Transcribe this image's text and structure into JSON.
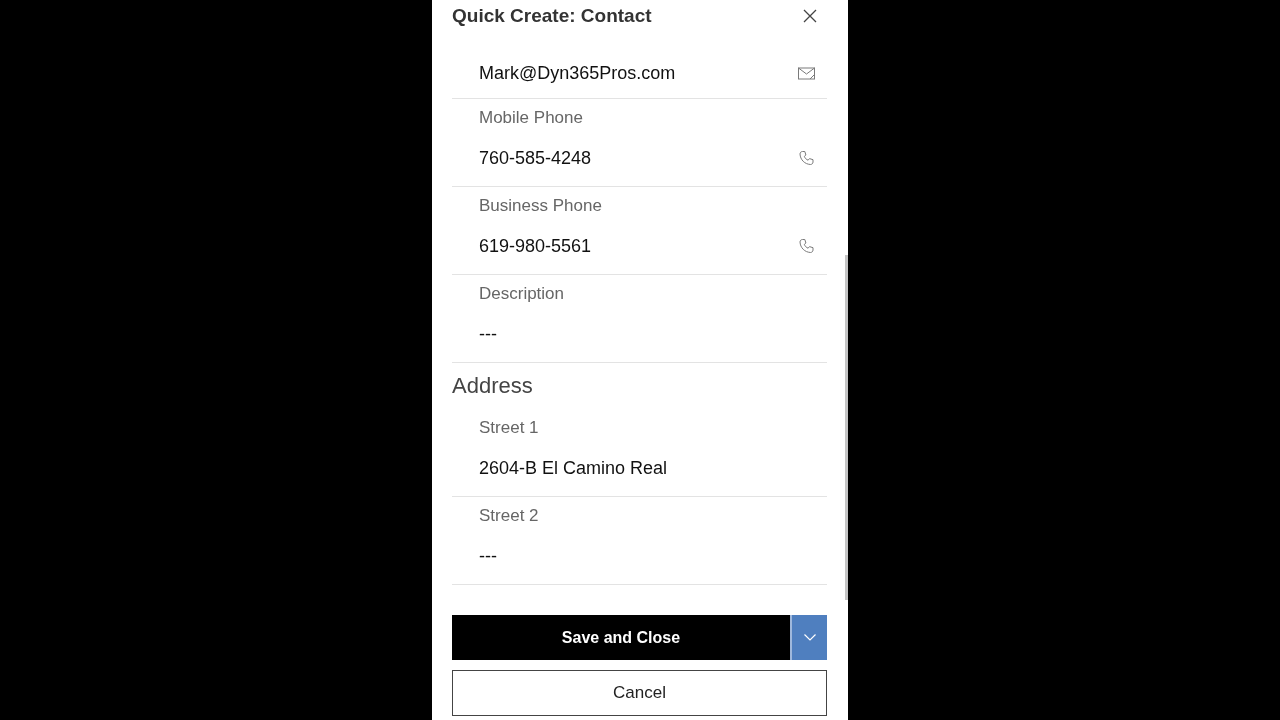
{
  "dialog": {
    "title": "Quick Create: Contact"
  },
  "sections": [
    {
      "fields": [
        {
          "kind": "email",
          "value": "Mark@Dyn365Pros.com"
        },
        {
          "kind": "phone",
          "label": "Mobile Phone",
          "value": "760-585-4248"
        },
        {
          "kind": "phone",
          "label": "Business Phone",
          "value": "619-980-5561"
        },
        {
          "kind": "text",
          "label": "Description",
          "value": "---"
        }
      ]
    },
    {
      "heading": "Address",
      "fields": [
        {
          "kind": "text",
          "label": "Street 1",
          "value": "2604-B El Camino Real"
        },
        {
          "kind": "text",
          "label": "Street 2",
          "value": "---"
        }
      ]
    }
  ],
  "actions": {
    "primary": "Save and Close",
    "secondary": "Cancel"
  }
}
